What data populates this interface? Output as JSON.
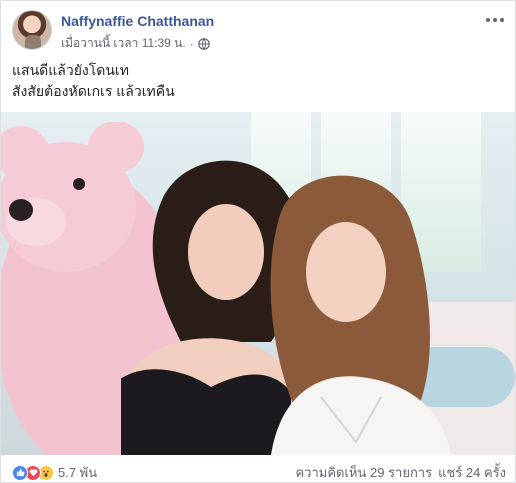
{
  "post": {
    "author": "Naffynaffie Chatthanan",
    "timestamp": "เมื่อวานนี้ เวลา 11:39 น.",
    "separator": "·",
    "privacy_icon": "globe-icon",
    "more_icon": "more-options-icon",
    "text_lines": [
      "แสนดีแล้วยังโดนเท",
      "สังสัยต้องหัดเกเร แล้วเทคืน"
    ],
    "photo_icon": "photo"
  },
  "footer": {
    "reaction_icons": [
      "like-icon",
      "love-icon",
      "wow-icon"
    ],
    "reaction_count": "5.7 พัน",
    "comments": "ความคิดเห็น 29 รายการ",
    "shares": "แชร์ 24 ครั้ง"
  },
  "colors": {
    "author_link": "#385898",
    "meta_text": "#616770",
    "like": "#4f84ec",
    "love": "#f0485f",
    "wow": "#f7c849"
  }
}
